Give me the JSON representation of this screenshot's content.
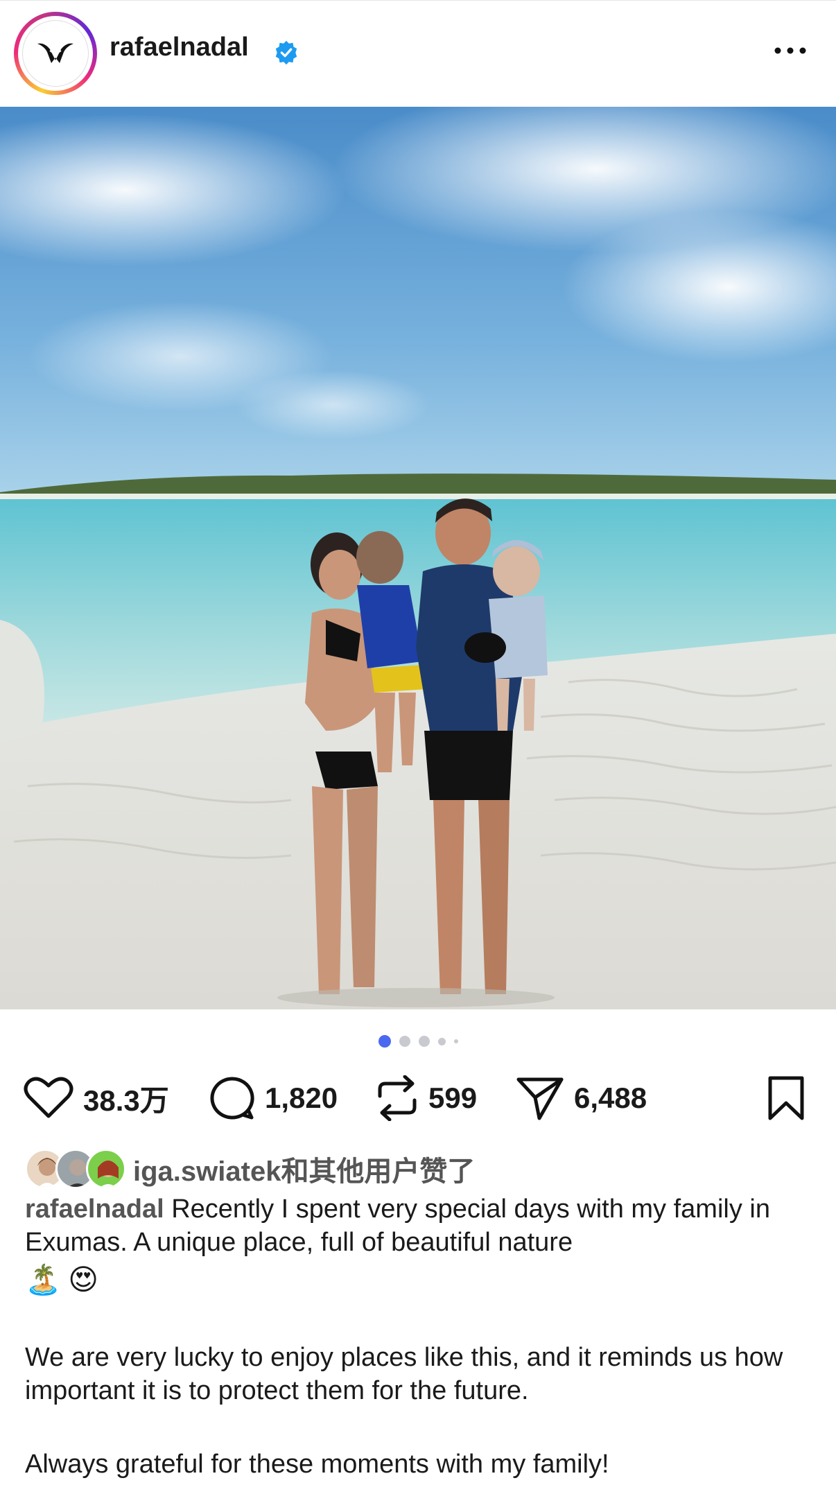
{
  "header": {
    "username": "rafaelnadal",
    "verified_icon": "verified-badge-icon",
    "more_icon": "more-options-icon"
  },
  "post": {
    "photo_description_icon": "beach-photo",
    "carousel": {
      "count": 5,
      "active_index": 0
    }
  },
  "actions": {
    "like": {
      "icon": "heart-icon",
      "count": "38.3万"
    },
    "comment": {
      "icon": "comment-icon",
      "count": "1,820"
    },
    "repost": {
      "icon": "repost-icon",
      "count": "599"
    },
    "share": {
      "icon": "send-icon",
      "count": "6,488"
    },
    "save": {
      "icon": "bookmark-icon"
    }
  },
  "liked_by": {
    "text": "iga.swiatek和其他用户赞了"
  },
  "caption": {
    "username": "rafaelnadal",
    "line1": "Recently I spent very special days with my family in Exumas. A unique place, full of beautiful nature",
    "emojis": [
      "🏝️",
      "😍"
    ],
    "para2": "We are very lucky to enjoy places like this, and it reminds us how important it is to protect them for the future.",
    "para3": "Always grateful for these moments with my family!"
  },
  "colors": {
    "accent": "#4a69f0",
    "verified": "#1d9bf0"
  }
}
